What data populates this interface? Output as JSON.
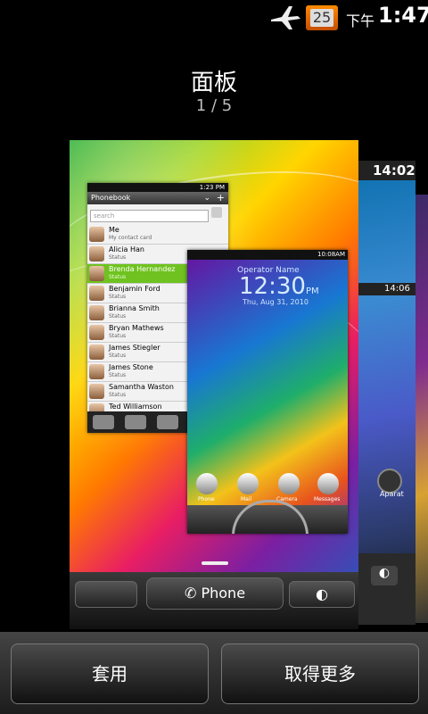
{
  "status_bar": {
    "calendar_day": "25",
    "ampm": "下午",
    "time": "1:47",
    "airplane_icon": "airplane-icon"
  },
  "header": {
    "title": "面板",
    "page_indicator": "1 / 5"
  },
  "main_panel": {
    "phonebook": {
      "status_time": "1:23 PM",
      "title": "Phonebook",
      "search_placeholder": "search",
      "contacts": [
        {
          "name": "Me",
          "status": "My contact card"
        },
        {
          "name": "Alicia Han",
          "status": "Status"
        },
        {
          "name": "Brenda Hernandez",
          "status": "Status"
        },
        {
          "name": "Benjamin Ford",
          "status": "Status"
        },
        {
          "name": "Brianna Smith",
          "status": "Status"
        },
        {
          "name": "Bryan Mathews",
          "status": "Status"
        },
        {
          "name": "James Stiegler",
          "status": "Status"
        },
        {
          "name": "James Stone",
          "status": "Status"
        },
        {
          "name": "Samantha Waston",
          "status": "Status"
        },
        {
          "name": "Ted Williamson",
          "status": ""
        }
      ]
    },
    "lockscreen": {
      "status_time": "10:08AM",
      "operator": "Operator Name",
      "time": "12:30",
      "ampm": "PM",
      "date": "Thu, Aug 31, 2010",
      "apps": [
        "Phone",
        "Mail",
        "Camera",
        "Messages"
      ]
    },
    "dock": {
      "phone_label": "Phone"
    }
  },
  "side_panel": {
    "time": "14:02",
    "small_time": "14:06",
    "app_label": "Aparat"
  },
  "buttons": {
    "apply": "套用",
    "get_more": "取得更多"
  }
}
